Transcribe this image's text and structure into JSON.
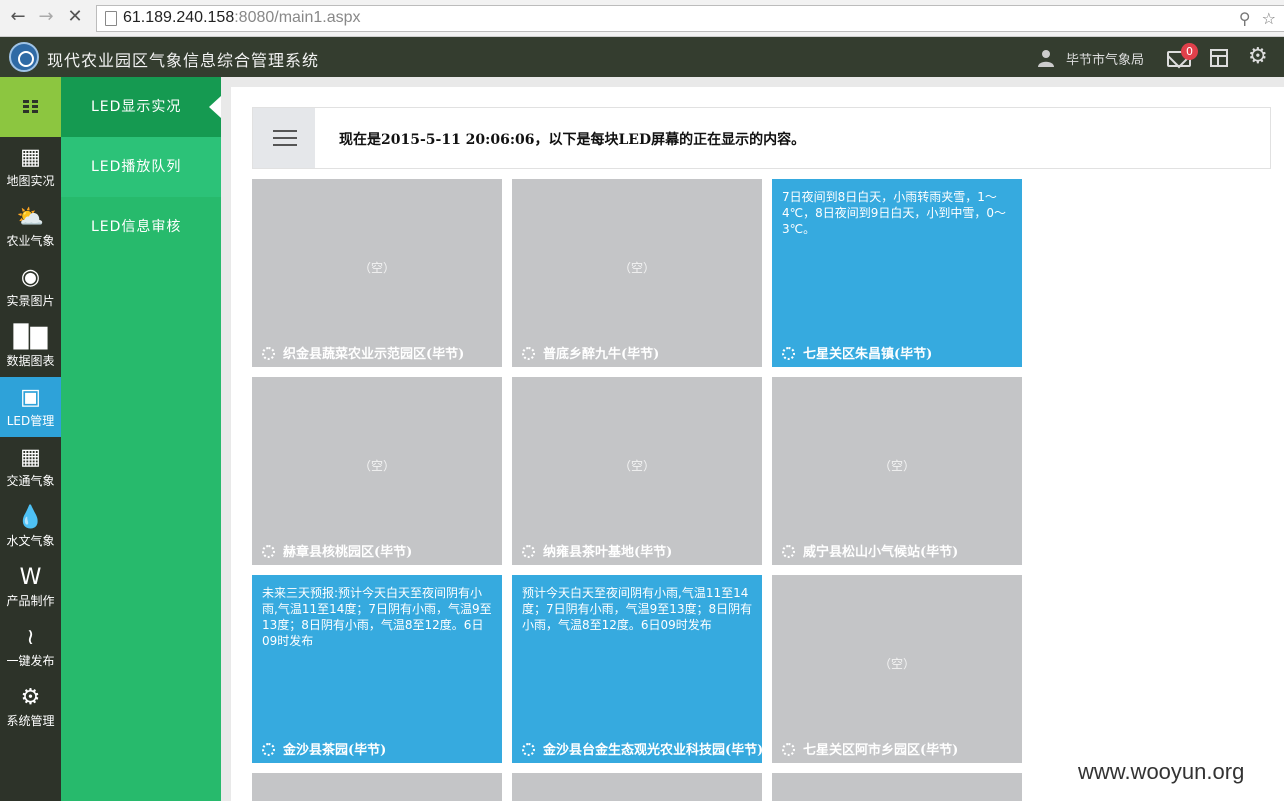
{
  "browser": {
    "url_host": "61.189.240.158",
    "url_rest": ":8080/main1.aspx"
  },
  "header": {
    "title": "现代农业园区气象信息综合管理系统",
    "user": "毕节市气象局",
    "mail_count": "0"
  },
  "rail": [
    {
      "label": "地图实况",
      "icon": "map-icon"
    },
    {
      "label": "农业气象",
      "icon": "cloud-sun-icon"
    },
    {
      "label": "实景图片",
      "icon": "camera-icon"
    },
    {
      "label": "数据图表",
      "icon": "bar-chart-icon"
    },
    {
      "label": "LED管理",
      "icon": "monitor-icon"
    },
    {
      "label": "交通气象",
      "icon": "train-icon"
    },
    {
      "label": "水文气象",
      "icon": "drop-icon"
    },
    {
      "label": "产品制作",
      "icon": "word-doc-icon"
    },
    {
      "label": "一键发布",
      "icon": "wifi-icon"
    },
    {
      "label": "系统管理",
      "icon": "gear-icon"
    }
  ],
  "subnav": [
    {
      "label": "LED显示实况"
    },
    {
      "label": "LED播放队列"
    },
    {
      "label": "LED信息审核"
    }
  ],
  "info": "现在是2015-5-11 20:06:06，以下是每块LED屏幕的正在显示的内容。",
  "tiles": [
    {
      "name": "织金县蔬菜农业示范园区(毕节)",
      "message": "",
      "empty": "（空）"
    },
    {
      "name": "普底乡醉九牛(毕节)",
      "message": "",
      "empty": "（空）"
    },
    {
      "name": "七星关区朱昌镇(毕节)",
      "message": "7日夜间到8日白天，小雨转雨夹雪，1～4℃，8日夜间到9日白天，小到中雪，0～3℃。",
      "empty": ""
    },
    {
      "name": "赫章县核桃园区(毕节)",
      "message": "",
      "empty": "（空）"
    },
    {
      "name": "纳雍县茶叶基地(毕节)",
      "message": "",
      "empty": "（空）"
    },
    {
      "name": "威宁县松山小气候站(毕节)",
      "message": "",
      "empty": "（空）"
    },
    {
      "name": "金沙县茶园(毕节)",
      "message": "未来三天预报:预计今天白天至夜间阴有小雨,气温11至14度；7日阴有小雨，气温9至13度；8日阴有小雨，气温8至12度。6日09时发布",
      "empty": ""
    },
    {
      "name": "金沙县台金生态观光农业科技园(毕节)",
      "message": "预计今天白天至夜间阴有小雨,气温11至14度；7日阴有小雨，气温9至13度；8日阴有小雨，气温8至12度。6日09时发布",
      "empty": ""
    },
    {
      "name": "七星关区阿市乡园区(毕节)",
      "message": "",
      "empty": "（空）"
    }
  ],
  "watermark": "www.wooyun.org"
}
